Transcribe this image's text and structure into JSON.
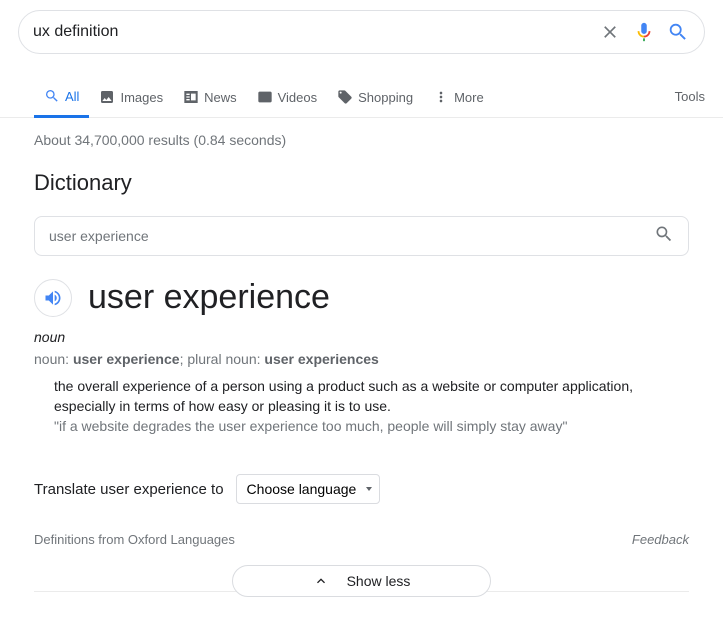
{
  "search": {
    "query": "ux definition"
  },
  "tabs": {
    "all": "All",
    "images": "Images",
    "news": "News",
    "videos": "Videos",
    "shopping": "Shopping",
    "more": "More",
    "tools": "Tools"
  },
  "stats": "About 34,700,000 results (0.84 seconds)",
  "dict": {
    "title": "Dictionary",
    "search_value": "user experience",
    "word": "user experience",
    "pos": "noun",
    "forms_prefix1": "noun: ",
    "forms_bold1": "user experience",
    "forms_mid": "; plural noun: ",
    "forms_bold2": "user experiences",
    "definition": "the overall experience of a person using a product such as a website or computer application, especially in terms of how easy or pleasing it is to use.",
    "example": "\"if a website degrades the user experience too much, people will simply stay away\"",
    "translate_label": "Translate user experience to",
    "lang_default": "Choose language",
    "source": "Definitions from Oxford Languages",
    "feedback": "Feedback",
    "showless": "Show less"
  }
}
